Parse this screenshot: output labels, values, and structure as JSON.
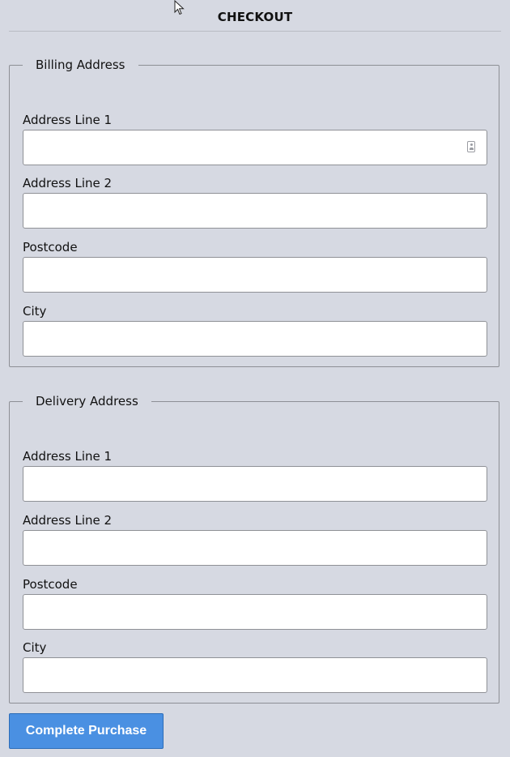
{
  "header": {
    "title": "CHECKOUT"
  },
  "billing": {
    "legend": "Billing Address",
    "fields": [
      {
        "label": "Address Line 1",
        "value": "",
        "icon": "contact-card-icon"
      },
      {
        "label": "Address Line 2",
        "value": ""
      },
      {
        "label": "Postcode",
        "value": ""
      },
      {
        "label": "City",
        "value": ""
      }
    ]
  },
  "delivery": {
    "legend": "Delivery Address",
    "fields": [
      {
        "label": "Address Line 1",
        "value": ""
      },
      {
        "label": "Address Line 2",
        "value": ""
      },
      {
        "label": "Postcode",
        "value": ""
      },
      {
        "label": "City",
        "value": ""
      }
    ]
  },
  "actions": {
    "submit_label": "Complete Purchase"
  },
  "colors": {
    "background": "#d6d9e2",
    "accent": "#4a90e2",
    "border": "#8f9196"
  }
}
